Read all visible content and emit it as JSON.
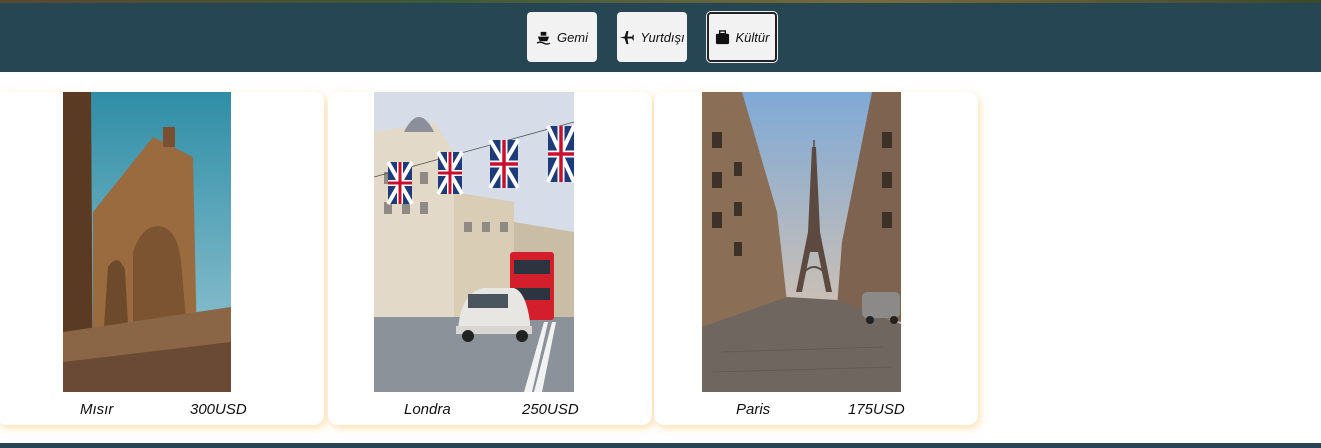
{
  "filters": [
    {
      "label": "Gemi",
      "icon": "ship-icon",
      "active": false
    },
    {
      "label": "Yurtdışı",
      "icon": "plane-icon",
      "active": false
    },
    {
      "label": "Kültür",
      "icon": "suitcase-icon",
      "active": true
    }
  ],
  "tours": [
    {
      "name": "Mısır",
      "price": "300USD",
      "image": "egypt-temple-photo"
    },
    {
      "name": "Londra",
      "price": "250USD",
      "image": "london-street-photo"
    },
    {
      "name": "Paris",
      "price": "175USD",
      "image": "paris-eiffel-photo"
    }
  ],
  "colors": {
    "navbar": "#274653",
    "card_glow": "#ffc46e"
  }
}
